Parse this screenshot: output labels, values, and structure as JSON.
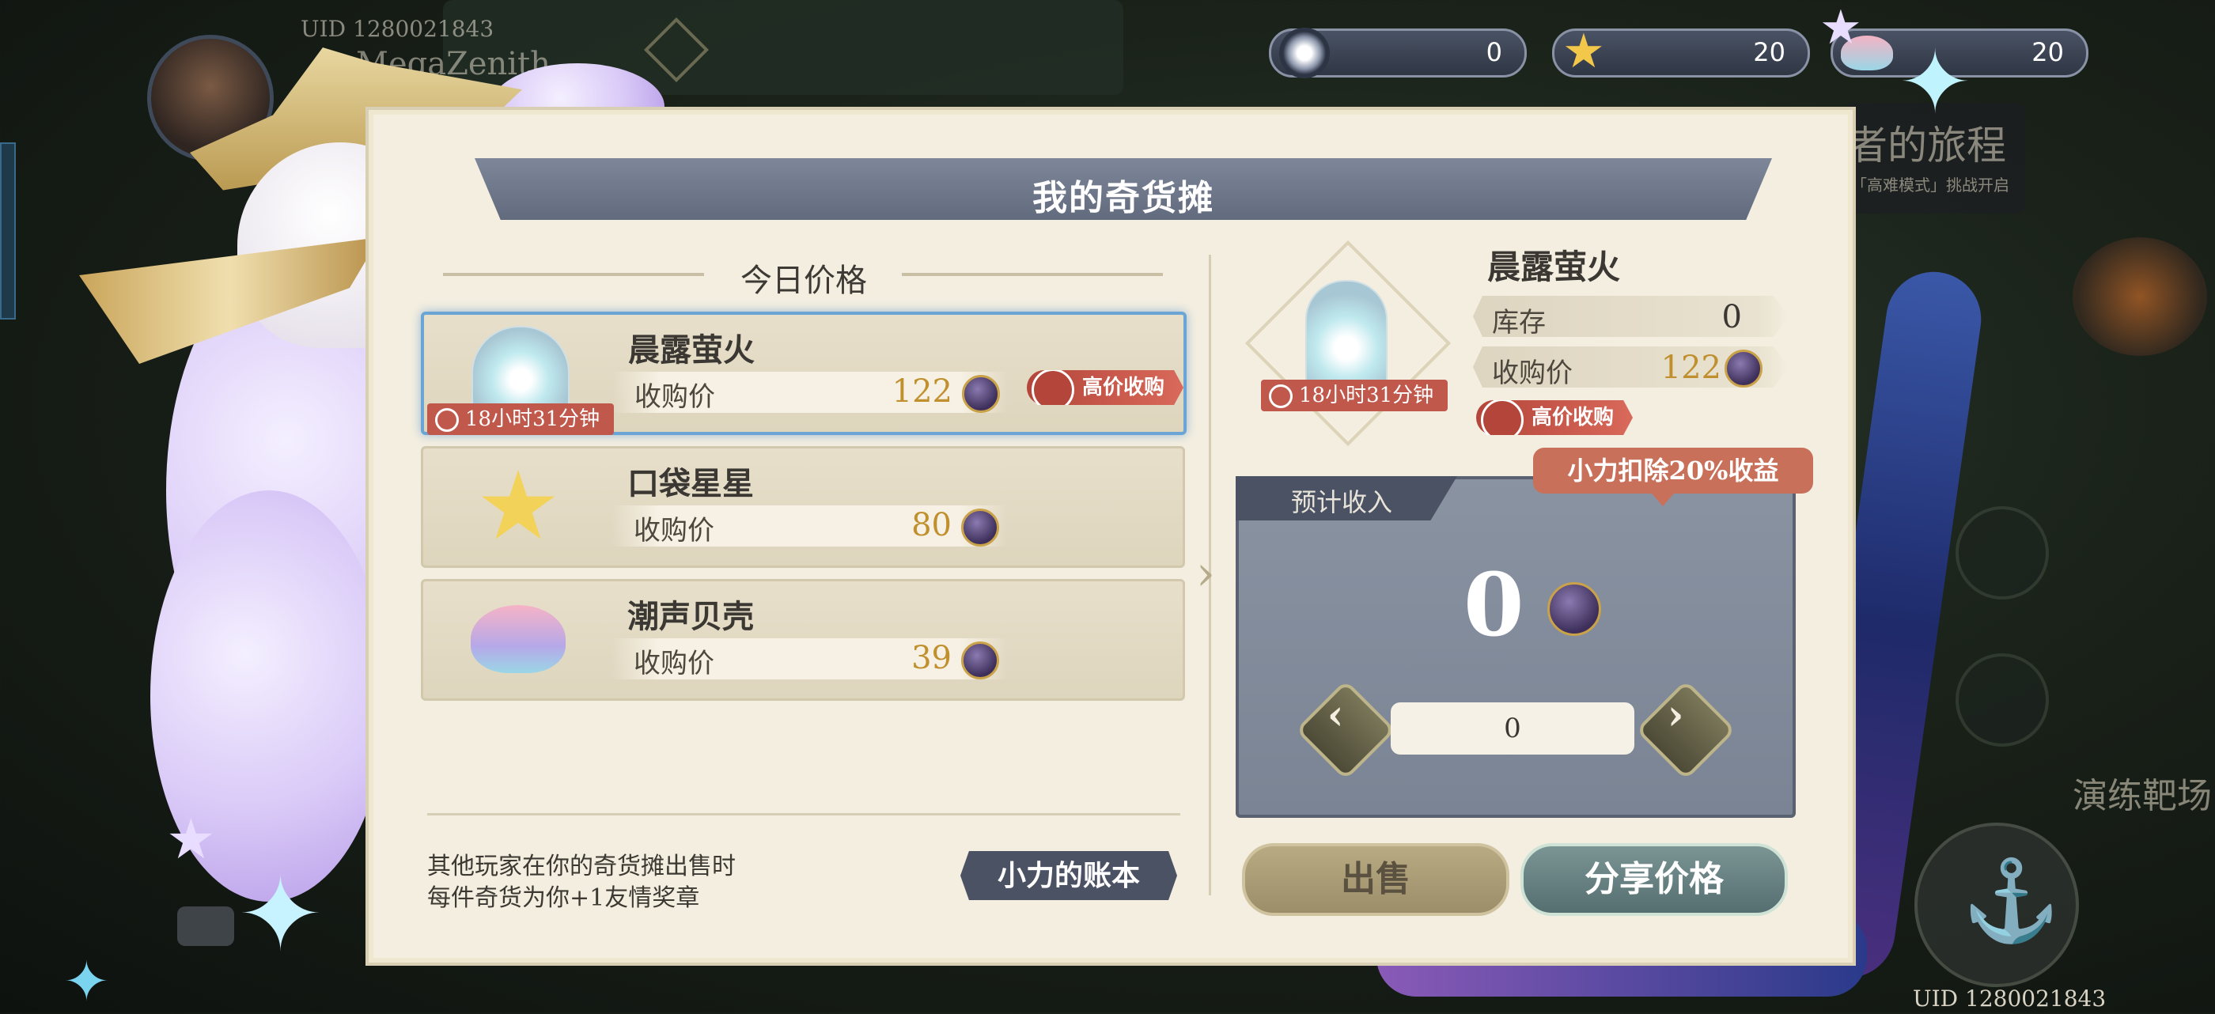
{
  "hud": {
    "uid_top": "UID 1280021843",
    "player_name": "MegaZenith",
    "uid_bottom": "UID 1280021843",
    "bg_banner": "者的旅程",
    "bg_banner_sub": "「高难模式」挑战开启",
    "bg_location": "演练靶场"
  },
  "currencies": [
    {
      "icon": "orb-icon",
      "value": "0"
    },
    {
      "icon": "pocket-star-icon",
      "value": "20"
    },
    {
      "icon": "tide-shell-icon",
      "value": "20"
    }
  ],
  "panel": {
    "title": "我的奇货摊",
    "section_title": "今日价格"
  },
  "items": [
    {
      "name": "晨露萤火",
      "price_label": "收购价",
      "price": "122",
      "timer": "18小时31分钟",
      "high_label": "高价收购"
    },
    {
      "name": "口袋星星",
      "price_label": "收购价",
      "price": "80"
    },
    {
      "name": "潮声贝壳",
      "price_label": "收购价",
      "price": "39"
    }
  ],
  "footer": {
    "note_line1": "其他玩家在你的奇货摊出售时",
    "note_line2": "每件奇货为你+1友情奖章",
    "ledger_button": "小力的账本"
  },
  "detail": {
    "name": "晨露萤火",
    "stock_label": "库存",
    "stock_value": "0",
    "price_label": "收购价",
    "price_value": "122",
    "timer": "18小时31分钟",
    "high_label": "高价收购",
    "income_tab": "预计收入",
    "deduct_tip": "小力扣除20%收益",
    "income_value": "0",
    "quantity": "0",
    "sell_button": "出售",
    "share_button": "分享价格"
  },
  "colors": {
    "accent_gold": "#c0902e",
    "badge_red": "#c0584b",
    "panel_bg": "#f3eee0",
    "title_bar": "#6f798b"
  }
}
